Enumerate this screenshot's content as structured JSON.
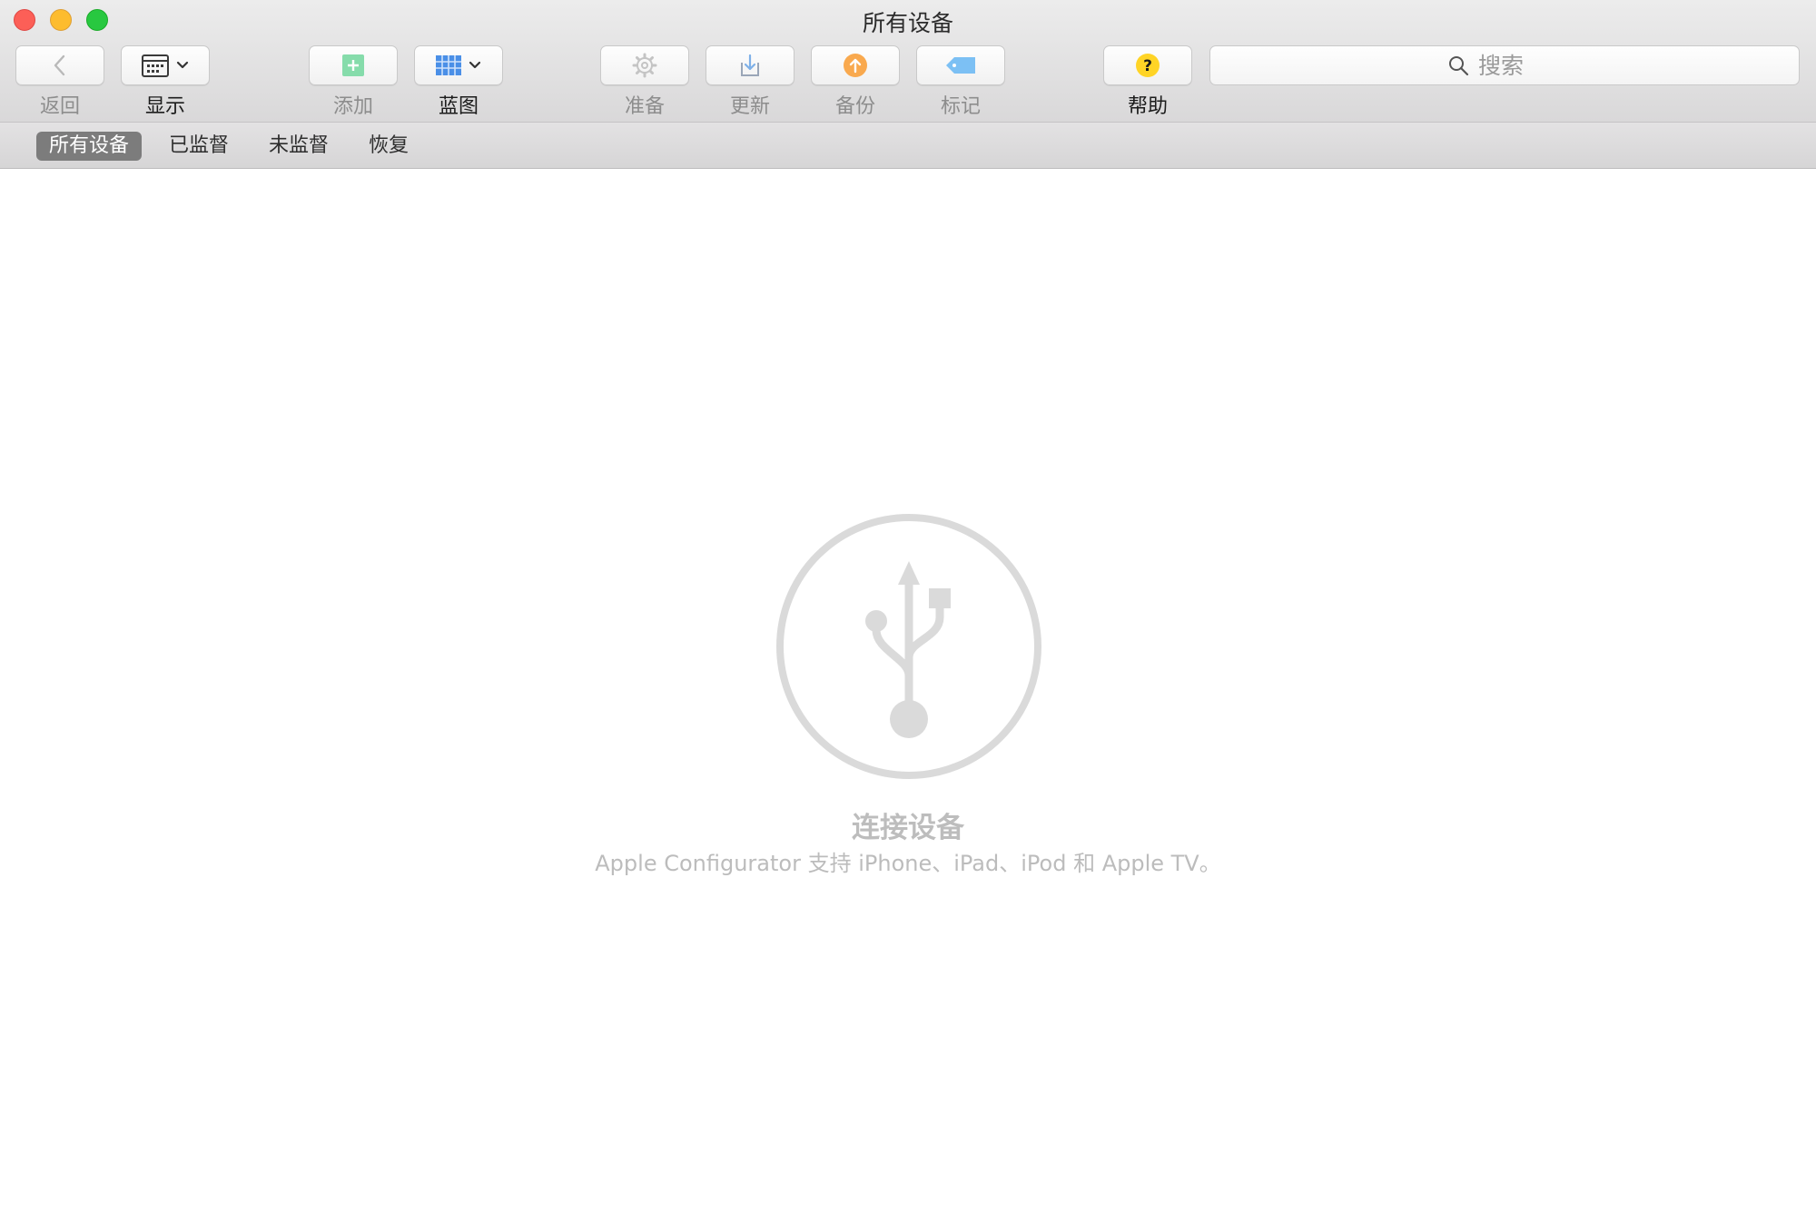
{
  "window": {
    "title": "所有设备"
  },
  "toolbar": {
    "back_label": "返回",
    "view_label": "显示",
    "add_label": "添加",
    "blueprints_label": "蓝图",
    "prepare_label": "准备",
    "update_label": "更新",
    "backup_label": "备份",
    "tag_label": "标记",
    "help_label": "帮助",
    "icons": {
      "back": "chevron-left-icon",
      "view": "calendar-grid-icon",
      "add": "plus-icon",
      "blueprints": "grid-icon",
      "prepare": "gear-icon",
      "update": "download-tray-icon",
      "backup": "upload-circle-icon",
      "tag": "tag-icon",
      "help": "question-icon"
    }
  },
  "search": {
    "placeholder": "搜索"
  },
  "scope_tabs": [
    {
      "label": "所有设备",
      "selected": true
    },
    {
      "label": "已监督",
      "selected": false
    },
    {
      "label": "未监督",
      "selected": false
    },
    {
      "label": "恢复",
      "selected": false
    }
  ],
  "empty_state": {
    "icon": "usb-icon",
    "title": "连接设备",
    "subtitle": "Apple Configurator 支持 iPhone、iPad、iPod 和 Apple TV。"
  },
  "colors": {
    "close": "#fc5f57",
    "minimize": "#fdbc2e",
    "zoom": "#28c840",
    "add_green": "#86dcab",
    "blueprint_blue": "#4a8fe7",
    "backup_orange": "#f9a94e",
    "tag_blue": "#7cc0f4",
    "help_yellow": "#ffd426",
    "empty_icon_gray": "#dadada"
  }
}
